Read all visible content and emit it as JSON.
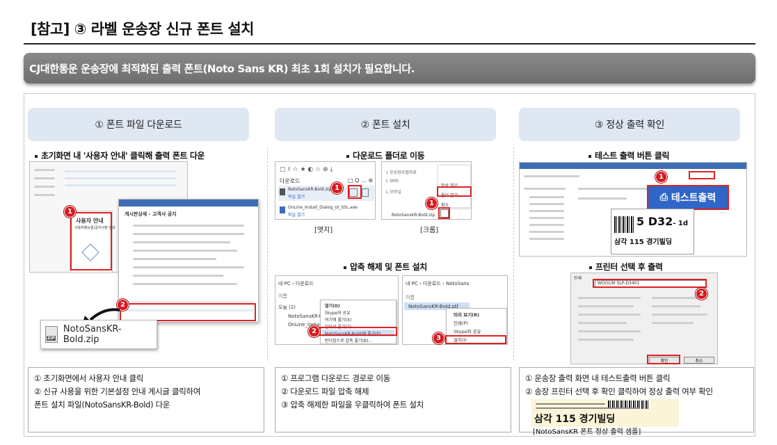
{
  "title": "[참고] ③ 라벨 운송장 신규 폰트 설치",
  "banner": "CJ대한통운 운송장에 최적화된 출력 폰트(Noto Sans KR) 최초 1회 설치가 필요합니다.",
  "columns": [
    {
      "header": "① 폰트 파일 다운로드",
      "sub1": "초기화면 내 '사용자 안내' 클릭해 출력 폰트 다운",
      "panel_text": "사용자 안내",
      "panel_link": "사용자매뉴얼/공지사항 안내",
      "popup_title": "게시판상세 - 고객사 공지",
      "file_name": "NotoSansKR-Bold.zip",
      "notes": [
        "① 초기화면에서 사용자 안내 클릭",
        "② 신규 사용을 위한 기본설정 안내 게시글 클릭하여",
        "    폰트 설치 파일(NotoSansKR-Bold) 다운"
      ]
    },
    {
      "header": "② 폰트 설치",
      "sub1": "다운로드 폴더로 이동",
      "edge_label": "[엣지]",
      "chrome_label": "[크롬]",
      "edge_title": "다운로드",
      "edge_file1": "NotoSansKR-Bold.zip",
      "edge_file1_sub": "파일 열기",
      "edge_file2": "OnLine_Install_Dialog_UI_SSL.exe",
      "edge_file2_sub": "파일 열기",
      "chrome_file": "NotoSansKR-Bold.zip",
      "chrome_menu": [
        "항상 열기",
        "폴더 열기",
        "취소"
      ],
      "sub2": "압축 해제 및 폰트 설치",
      "explorer_path1": "내 PC › 다운로드",
      "explorer_path2": "내 PC › 다운로드 › NotoSans",
      "explorer_group": "오늘 (2)",
      "explorer_file1": "NotoSansKR-Bold",
      "explorer_file2": "OnLine_Install_Dial",
      "context_menu1": [
        "열기(O)",
        "Skype와 공유",
        "여기에 풀기(X)",
        "알아서 풀기(Z)",
        "NotoSansKR-Bold\\에 풀기(E)",
        "반디집으로 압축 풀기(B)..."
      ],
      "explorer_file3": "NotoSansKR-Bold.otf",
      "context_menu2": [
        "미리 보기(R)",
        "인쇄(P)",
        "Skype와 공유",
        "설치(I)"
      ],
      "notes": [
        "① 프로그램 다운로드 경로로 이동",
        "② 다운로드 파일 압축 해제",
        "③ 압축 해제한 파일을 우클릭하여 폰트 설치"
      ]
    },
    {
      "header": "③ 정상 출력 확인",
      "sub1": "테스트 출력 버튼 클릭",
      "test_button": "테스트출력",
      "label_code": "5 D32",
      "label_suffix": "- 1d",
      "label_addr": "삼각 115 경기빌딩",
      "sub2": "프린터 선택 후 출력",
      "printer_name": "WOOLIM SLP-D3401",
      "print_ok": "확인",
      "print_cancel": "취소",
      "sample_addr": "삼각 115 경기빌딩",
      "sample_caption": "[NotoSansKR 폰트 정상 출력 샘플]",
      "notes": [
        "① 운송장 출력 화면 내 테스트출력 버튼 클릭",
        "② 송장 프린터 선택 후 확인 클릭하여 정상 출력 여부 확인"
      ]
    }
  ],
  "colors": {
    "accent": "#d71920",
    "header_bg": "#dfe7f3",
    "banner": "#7a7a7a",
    "blue": "#3d6db5"
  }
}
